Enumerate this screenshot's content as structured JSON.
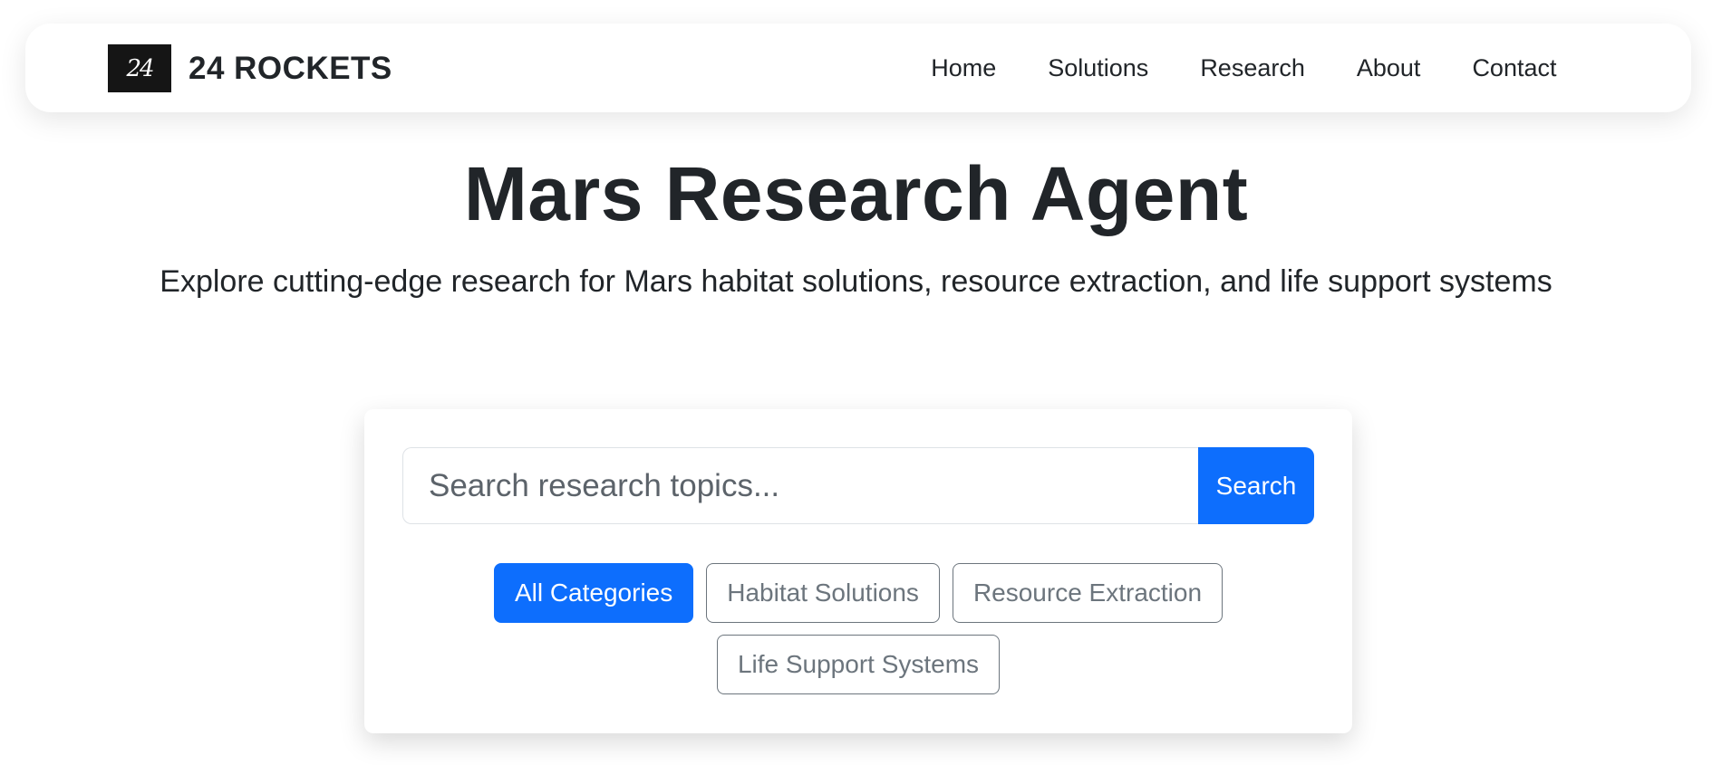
{
  "navbar": {
    "logo_text": "24",
    "brand_name": "24 ROCKETS",
    "links": [
      "Home",
      "Solutions",
      "Research",
      "About",
      "Contact"
    ]
  },
  "hero": {
    "title": "Mars Research Agent",
    "subtitle": "Explore cutting-edge research for Mars habitat solutions, resource extraction, and life support systems"
  },
  "search": {
    "placeholder": "Search research topics...",
    "value": "",
    "button_label": "Search"
  },
  "filters": {
    "items": [
      "All Categories",
      "Habitat Solutions",
      "Resource Extraction",
      "Life Support Systems"
    ],
    "active": "All Categories"
  },
  "colors": {
    "primary": "#0d6efd",
    "text": "#212529",
    "secondary": "#6c757d",
    "logo_bg": "#151515"
  },
  "icons": {
    "logo": "24-rockets-logo-icon"
  }
}
